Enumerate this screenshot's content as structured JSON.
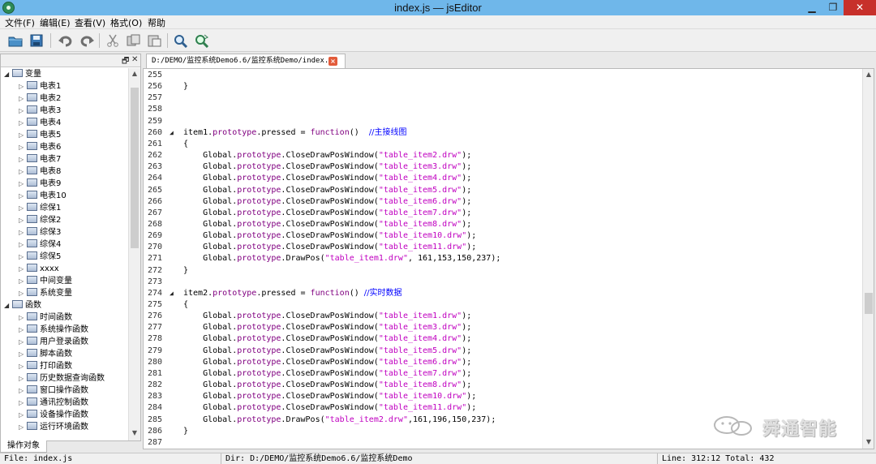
{
  "window": {
    "title": "index.js — jsEditor"
  },
  "menu": [
    "文件(F)",
    "编辑(E)",
    "查看(V)",
    "格式(O)",
    "帮助"
  ],
  "toolbar": {
    "icons": [
      "open-folder-icon",
      "save-icon",
      "undo-icon",
      "redo-icon",
      "cut-icon",
      "copy-icon",
      "paste-icon",
      "find-icon",
      "replace-icon"
    ]
  },
  "left_panel": {
    "header_buttons": [
      "🗗",
      "✕"
    ],
    "tree": [
      {
        "label": "变量",
        "level": 0,
        "expanded": true
      },
      {
        "label": "电表1",
        "level": 1
      },
      {
        "label": "电表2",
        "level": 1
      },
      {
        "label": "电表3",
        "level": 1
      },
      {
        "label": "电表4",
        "level": 1
      },
      {
        "label": "电表5",
        "level": 1
      },
      {
        "label": "电表6",
        "level": 1
      },
      {
        "label": "电表7",
        "level": 1
      },
      {
        "label": "电表8",
        "level": 1
      },
      {
        "label": "电表9",
        "level": 1
      },
      {
        "label": "电表10",
        "level": 1
      },
      {
        "label": "综保1",
        "level": 1
      },
      {
        "label": "综保2",
        "level": 1
      },
      {
        "label": "综保3",
        "level": 1
      },
      {
        "label": "综保4",
        "level": 1
      },
      {
        "label": "综保5",
        "level": 1
      },
      {
        "label": "xxxx",
        "level": 1
      },
      {
        "label": "中间变量",
        "level": 1
      },
      {
        "label": "系统变量",
        "level": 1
      },
      {
        "label": "函数",
        "level": 0,
        "expanded": true
      },
      {
        "label": "时间函数",
        "level": 1
      },
      {
        "label": "系统操作函数",
        "level": 1
      },
      {
        "label": "用户登录函数",
        "level": 1
      },
      {
        "label": "脚本函数",
        "level": 1
      },
      {
        "label": "打印函数",
        "level": 1
      },
      {
        "label": "历史数据查询函数",
        "level": 1
      },
      {
        "label": "窗口操作函数",
        "level": 1
      },
      {
        "label": "通讯控制函数",
        "level": 1
      },
      {
        "label": "设备操作函数",
        "level": 1
      },
      {
        "label": "运行环境函数",
        "level": 1
      }
    ],
    "bottom_tab": "操作对象"
  },
  "editor": {
    "tab_label": "D:/DEMO/监控系统Demo6.6/监控系统Demo/index.js",
    "lines": [
      {
        "n": "255",
        "segs": []
      },
      {
        "n": "256",
        "segs": [
          {
            "t": "}",
            "c": "p"
          }
        ]
      },
      {
        "n": "257",
        "segs": []
      },
      {
        "n": "258",
        "segs": []
      },
      {
        "n": "259",
        "segs": []
      },
      {
        "n": "260",
        "fold": "◢",
        "segs": [
          {
            "t": "item1.",
            "c": "p"
          },
          {
            "t": "prototype",
            "c": "k"
          },
          {
            "t": ".pressed = ",
            "c": "p"
          },
          {
            "t": "function",
            "c": "k"
          },
          {
            "t": "()  ",
            "c": "p"
          },
          {
            "t": "//主接线图",
            "c": "m"
          }
        ]
      },
      {
        "n": "261",
        "segs": [
          {
            "t": "{",
            "c": "p"
          }
        ]
      },
      {
        "n": "262",
        "segs": [
          {
            "t": "    Global.",
            "c": "p"
          },
          {
            "t": "prototype",
            "c": "k"
          },
          {
            "t": ".CloseDrawPosWindow(",
            "c": "p"
          },
          {
            "t": "\"table_item2.drw\"",
            "c": "s"
          },
          {
            "t": ");",
            "c": "p"
          }
        ]
      },
      {
        "n": "263",
        "segs": [
          {
            "t": "    Global.",
            "c": "p"
          },
          {
            "t": "prototype",
            "c": "k"
          },
          {
            "t": ".CloseDrawPosWindow(",
            "c": "p"
          },
          {
            "t": "\"table_item3.drw\"",
            "c": "s"
          },
          {
            "t": ");",
            "c": "p"
          }
        ]
      },
      {
        "n": "264",
        "segs": [
          {
            "t": "    Global.",
            "c": "p"
          },
          {
            "t": "prototype",
            "c": "k"
          },
          {
            "t": ".CloseDrawPosWindow(",
            "c": "p"
          },
          {
            "t": "\"table_item4.drw\"",
            "c": "s"
          },
          {
            "t": ");",
            "c": "p"
          }
        ]
      },
      {
        "n": "265",
        "segs": [
          {
            "t": "    Global.",
            "c": "p"
          },
          {
            "t": "prototype",
            "c": "k"
          },
          {
            "t": ".CloseDrawPosWindow(",
            "c": "p"
          },
          {
            "t": "\"table_item5.drw\"",
            "c": "s"
          },
          {
            "t": ");",
            "c": "p"
          }
        ]
      },
      {
        "n": "266",
        "segs": [
          {
            "t": "    Global.",
            "c": "p"
          },
          {
            "t": "prototype",
            "c": "k"
          },
          {
            "t": ".CloseDrawPosWindow(",
            "c": "p"
          },
          {
            "t": "\"table_item6.drw\"",
            "c": "s"
          },
          {
            "t": ");",
            "c": "p"
          }
        ]
      },
      {
        "n": "267",
        "segs": [
          {
            "t": "    Global.",
            "c": "p"
          },
          {
            "t": "prototype",
            "c": "k"
          },
          {
            "t": ".CloseDrawPosWindow(",
            "c": "p"
          },
          {
            "t": "\"table_item7.drw\"",
            "c": "s"
          },
          {
            "t": ");",
            "c": "p"
          }
        ]
      },
      {
        "n": "268",
        "segs": [
          {
            "t": "    Global.",
            "c": "p"
          },
          {
            "t": "prototype",
            "c": "k"
          },
          {
            "t": ".CloseDrawPosWindow(",
            "c": "p"
          },
          {
            "t": "\"table_item8.drw\"",
            "c": "s"
          },
          {
            "t": ");",
            "c": "p"
          }
        ]
      },
      {
        "n": "269",
        "segs": [
          {
            "t": "    Global.",
            "c": "p"
          },
          {
            "t": "prototype",
            "c": "k"
          },
          {
            "t": ".CloseDrawPosWindow(",
            "c": "p"
          },
          {
            "t": "\"table_item10.drw\"",
            "c": "s"
          },
          {
            "t": ");",
            "c": "p"
          }
        ]
      },
      {
        "n": "270",
        "segs": [
          {
            "t": "    Global.",
            "c": "p"
          },
          {
            "t": "prototype",
            "c": "k"
          },
          {
            "t": ".CloseDrawPosWindow(",
            "c": "p"
          },
          {
            "t": "\"table_item11.drw\"",
            "c": "s"
          },
          {
            "t": ");",
            "c": "p"
          }
        ]
      },
      {
        "n": "271",
        "segs": [
          {
            "t": "    Global.",
            "c": "p"
          },
          {
            "t": "prototype",
            "c": "k"
          },
          {
            "t": ".DrawPos(",
            "c": "p"
          },
          {
            "t": "\"table_item1.drw\"",
            "c": "s"
          },
          {
            "t": ", 161,153,150,237);",
            "c": "p"
          }
        ]
      },
      {
        "n": "272",
        "segs": [
          {
            "t": "}",
            "c": "p"
          }
        ]
      },
      {
        "n": "273",
        "segs": []
      },
      {
        "n": "274",
        "fold": "◢",
        "segs": [
          {
            "t": "item2.",
            "c": "p"
          },
          {
            "t": "prototype",
            "c": "k"
          },
          {
            "t": ".pressed = ",
            "c": "p"
          },
          {
            "t": "function",
            "c": "k"
          },
          {
            "t": "() ",
            "c": "p"
          },
          {
            "t": "//实时数据",
            "c": "m"
          }
        ]
      },
      {
        "n": "275",
        "segs": [
          {
            "t": "{",
            "c": "p"
          }
        ]
      },
      {
        "n": "276",
        "segs": [
          {
            "t": "    Global.",
            "c": "p"
          },
          {
            "t": "prototype",
            "c": "k"
          },
          {
            "t": ".CloseDrawPosWindow(",
            "c": "p"
          },
          {
            "t": "\"table_item1.drw\"",
            "c": "s"
          },
          {
            "t": ");",
            "c": "p"
          }
        ]
      },
      {
        "n": "277",
        "segs": [
          {
            "t": "    Global.",
            "c": "p"
          },
          {
            "t": "prototype",
            "c": "k"
          },
          {
            "t": ".CloseDrawPosWindow(",
            "c": "p"
          },
          {
            "t": "\"table_item3.drw\"",
            "c": "s"
          },
          {
            "t": ");",
            "c": "p"
          }
        ]
      },
      {
        "n": "278",
        "segs": [
          {
            "t": "    Global.",
            "c": "p"
          },
          {
            "t": "prototype",
            "c": "k"
          },
          {
            "t": ".CloseDrawPosWindow(",
            "c": "p"
          },
          {
            "t": "\"table_item4.drw\"",
            "c": "s"
          },
          {
            "t": ");",
            "c": "p"
          }
        ]
      },
      {
        "n": "279",
        "segs": [
          {
            "t": "    Global.",
            "c": "p"
          },
          {
            "t": "prototype",
            "c": "k"
          },
          {
            "t": ".CloseDrawPosWindow(",
            "c": "p"
          },
          {
            "t": "\"table_item5.drw\"",
            "c": "s"
          },
          {
            "t": ");",
            "c": "p"
          }
        ]
      },
      {
        "n": "280",
        "segs": [
          {
            "t": "    Global.",
            "c": "p"
          },
          {
            "t": "prototype",
            "c": "k"
          },
          {
            "t": ".CloseDrawPosWindow(",
            "c": "p"
          },
          {
            "t": "\"table_item6.drw\"",
            "c": "s"
          },
          {
            "t": ");",
            "c": "p"
          }
        ]
      },
      {
        "n": "281",
        "segs": [
          {
            "t": "    Global.",
            "c": "p"
          },
          {
            "t": "prototype",
            "c": "k"
          },
          {
            "t": ".CloseDrawPosWindow(",
            "c": "p"
          },
          {
            "t": "\"table_item7.drw\"",
            "c": "s"
          },
          {
            "t": ");",
            "c": "p"
          }
        ]
      },
      {
        "n": "282",
        "segs": [
          {
            "t": "    Global.",
            "c": "p"
          },
          {
            "t": "prototype",
            "c": "k"
          },
          {
            "t": ".CloseDrawPosWindow(",
            "c": "p"
          },
          {
            "t": "\"table_item8.drw\"",
            "c": "s"
          },
          {
            "t": ");",
            "c": "p"
          }
        ]
      },
      {
        "n": "283",
        "segs": [
          {
            "t": "    Global.",
            "c": "p"
          },
          {
            "t": "prototype",
            "c": "k"
          },
          {
            "t": ".CloseDrawPosWindow(",
            "c": "p"
          },
          {
            "t": "\"table_item10.drw\"",
            "c": "s"
          },
          {
            "t": ");",
            "c": "p"
          }
        ]
      },
      {
        "n": "284",
        "segs": [
          {
            "t": "    Global.",
            "c": "p"
          },
          {
            "t": "prototype",
            "c": "k"
          },
          {
            "t": ".CloseDrawPosWindow(",
            "c": "p"
          },
          {
            "t": "\"table_item11.drw\"",
            "c": "s"
          },
          {
            "t": ");",
            "c": "p"
          }
        ]
      },
      {
        "n": "285",
        "segs": [
          {
            "t": "    Global.",
            "c": "p"
          },
          {
            "t": "prototype",
            "c": "k"
          },
          {
            "t": ".DrawPos(",
            "c": "p"
          },
          {
            "t": "\"table_item2.drw\"",
            "c": "s"
          },
          {
            "t": ",161,196,150,237);",
            "c": "p"
          }
        ]
      },
      {
        "n": "286",
        "segs": [
          {
            "t": "}",
            "c": "p"
          }
        ]
      },
      {
        "n": "287",
        "segs": []
      }
    ]
  },
  "watermark": {
    "text": "舜通智能"
  },
  "status": {
    "file": "File: index.js",
    "dir": "Dir: D:/DEMO/监控系统Demo6.6/监控系统Demo",
    "position": "Line: 312:12 Total: 432"
  },
  "colors": {
    "titlebar": "#6fb7ea",
    "keyword": "#800080",
    "string": "#c000c0",
    "comment": "#0000ff",
    "close_button": "#c7302b"
  }
}
